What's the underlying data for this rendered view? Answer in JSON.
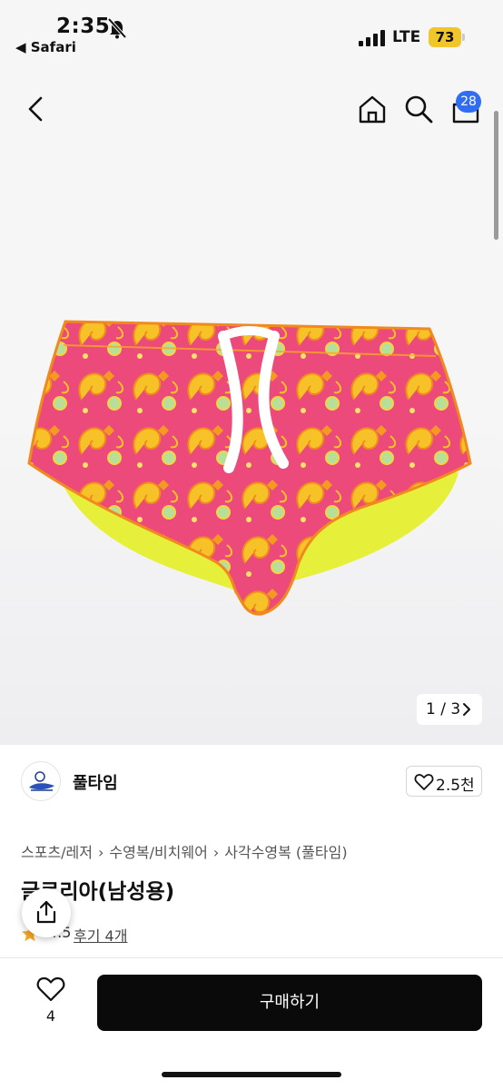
{
  "status_bar": {
    "time": "2:35",
    "back_app": "◀ Safari",
    "network": "LTE",
    "battery": "73"
  },
  "nav": {
    "cart_count": "28",
    "icons": [
      "back-chevron-icon",
      "home-icon",
      "search-icon",
      "shopping-bag-icon"
    ]
  },
  "gallery": {
    "pager": "1 / 3"
  },
  "seller": {
    "name": "풀타임",
    "likes": "2.5천"
  },
  "product": {
    "breadcrumb": [
      "스포츠/레저",
      "수영복/비치웨어",
      "사각수영복 (풀타임)"
    ],
    "title": "글로리아(남성용)",
    "rating": "4.5",
    "reviews": "후기 4개"
  },
  "bottom_bar": {
    "wish_count": "4",
    "buy_label": "구매하기"
  },
  "colors": {
    "accent_badge": "#2f6ef2",
    "battery": "#f1c62c",
    "buy_button": "#0a0a0a",
    "star": "#f6a623"
  }
}
